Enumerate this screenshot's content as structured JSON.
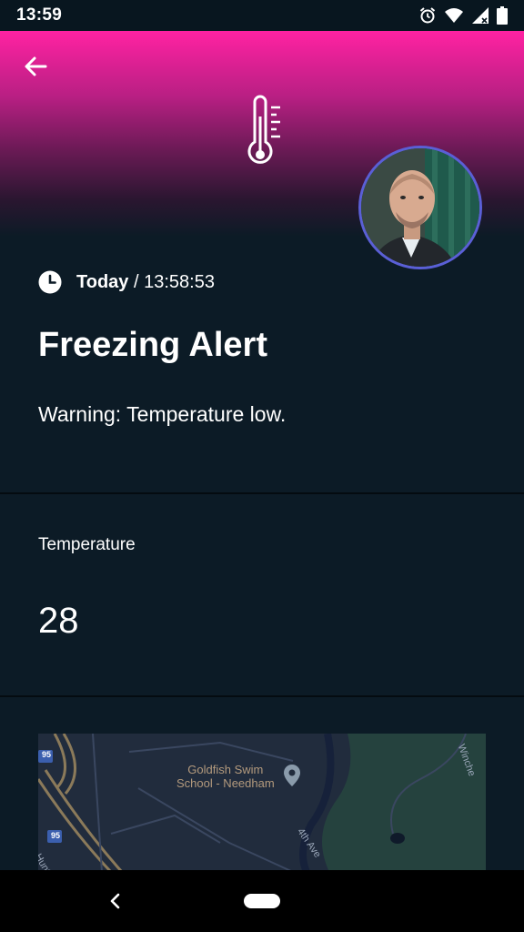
{
  "status_bar": {
    "time": "13:59"
  },
  "alert": {
    "date_label": "Today",
    "separator": " / ",
    "time": "13:58:53",
    "title": "Freezing Alert",
    "message": "Warning: Temperature low."
  },
  "metric": {
    "label": "Temperature",
    "value": "28"
  },
  "map": {
    "poi_name_line1": "Goldfish Swim",
    "poi_name_line2": "School - Needham",
    "street_4th": "4th Ave",
    "street_hunt": "Hunt",
    "street_winch": "Winche",
    "interstate_shield": "95"
  },
  "colors": {
    "header_top": "#ff22a2",
    "background": "#0c1b26",
    "avatar_border": "#5a5fd6"
  },
  "icons": [
    "back-arrow-icon",
    "thermometer-icon",
    "clock-icon",
    "alarm-icon",
    "wifi-icon",
    "cell-signal-icon",
    "battery-icon",
    "map-pin-icon",
    "nav-back-icon"
  ]
}
